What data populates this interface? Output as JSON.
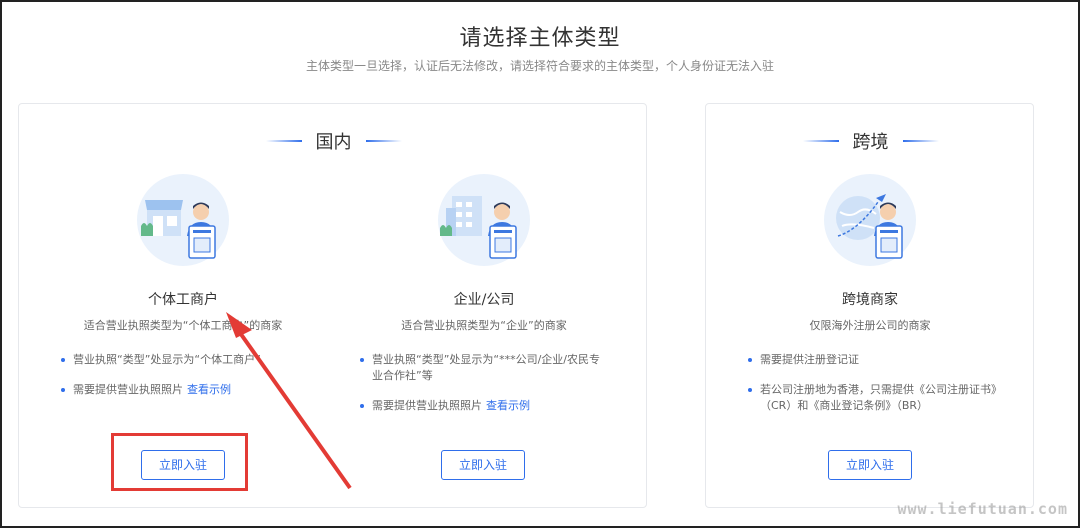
{
  "page": {
    "title": "请选择主体类型",
    "subtitle": "主体类型一旦选择，认证后无法修改，请选择符合要求的主体类型，个人身份证无法入驻"
  },
  "domestic": {
    "heading": "国内",
    "cards": [
      {
        "title": "个体工商户",
        "desc": "适合营业执照类型为“个体工商户”的商家",
        "bullets": [
          "营业执照“类型”处显示为“个体工商户”",
          "需要提供营业执照照片"
        ],
        "link": "查看示例",
        "cta": "立即入驻",
        "illustration": "shop-person-icon"
      },
      {
        "title": "企业/公司",
        "desc": "适合营业执照类型为“企业”的商家",
        "bullets": [
          "营业执照“类型”处显示为“***公司/企业/农民专业合作社”等",
          "需要提供营业执照照片"
        ],
        "link": "查看示例",
        "cta": "立即入驻",
        "illustration": "building-person-icon"
      }
    ]
  },
  "crossborder": {
    "heading": "跨境",
    "card": {
      "title": "跨境商家",
      "desc": "仅限海外注册公司的商家",
      "bullets": [
        "需要提供注册登记证",
        "若公司注册地为香港，只需提供《公司注册证书》（CR）和《商业登记条例》（BR）"
      ],
      "cta": "立即入驻",
      "illustration": "globe-plane-person-icon"
    }
  },
  "annotation": {
    "highlight_color": "#e33b35"
  },
  "watermark": "www.liefutuan.com",
  "colors": {
    "accent": "#2f6eeb",
    "illustration_bg": "#eaf2fc"
  }
}
